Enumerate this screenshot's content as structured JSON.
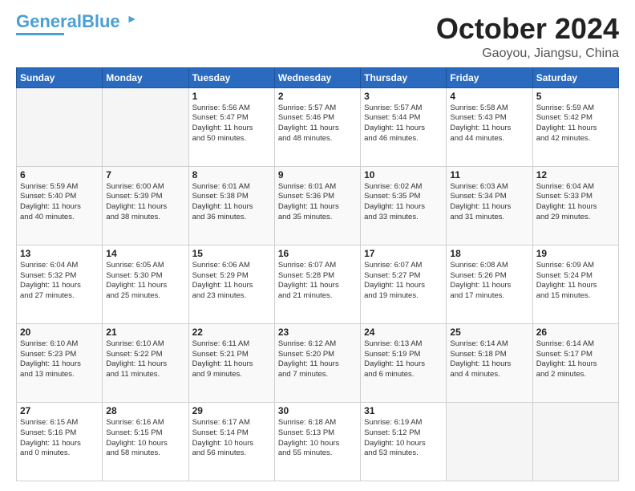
{
  "header": {
    "logo_general": "General",
    "logo_blue": "Blue",
    "month_year": "October 2024",
    "location": "Gaoyou, Jiangsu, China"
  },
  "days_of_week": [
    "Sunday",
    "Monday",
    "Tuesday",
    "Wednesday",
    "Thursday",
    "Friday",
    "Saturday"
  ],
  "weeks": [
    [
      {
        "day": "",
        "info": ""
      },
      {
        "day": "",
        "info": ""
      },
      {
        "day": "1",
        "info": "Sunrise: 5:56 AM\nSunset: 5:47 PM\nDaylight: 11 hours\nand 50 minutes."
      },
      {
        "day": "2",
        "info": "Sunrise: 5:57 AM\nSunset: 5:46 PM\nDaylight: 11 hours\nand 48 minutes."
      },
      {
        "day": "3",
        "info": "Sunrise: 5:57 AM\nSunset: 5:44 PM\nDaylight: 11 hours\nand 46 minutes."
      },
      {
        "day": "4",
        "info": "Sunrise: 5:58 AM\nSunset: 5:43 PM\nDaylight: 11 hours\nand 44 minutes."
      },
      {
        "day": "5",
        "info": "Sunrise: 5:59 AM\nSunset: 5:42 PM\nDaylight: 11 hours\nand 42 minutes."
      }
    ],
    [
      {
        "day": "6",
        "info": "Sunrise: 5:59 AM\nSunset: 5:40 PM\nDaylight: 11 hours\nand 40 minutes."
      },
      {
        "day": "7",
        "info": "Sunrise: 6:00 AM\nSunset: 5:39 PM\nDaylight: 11 hours\nand 38 minutes."
      },
      {
        "day": "8",
        "info": "Sunrise: 6:01 AM\nSunset: 5:38 PM\nDaylight: 11 hours\nand 36 minutes."
      },
      {
        "day": "9",
        "info": "Sunrise: 6:01 AM\nSunset: 5:36 PM\nDaylight: 11 hours\nand 35 minutes."
      },
      {
        "day": "10",
        "info": "Sunrise: 6:02 AM\nSunset: 5:35 PM\nDaylight: 11 hours\nand 33 minutes."
      },
      {
        "day": "11",
        "info": "Sunrise: 6:03 AM\nSunset: 5:34 PM\nDaylight: 11 hours\nand 31 minutes."
      },
      {
        "day": "12",
        "info": "Sunrise: 6:04 AM\nSunset: 5:33 PM\nDaylight: 11 hours\nand 29 minutes."
      }
    ],
    [
      {
        "day": "13",
        "info": "Sunrise: 6:04 AM\nSunset: 5:32 PM\nDaylight: 11 hours\nand 27 minutes."
      },
      {
        "day": "14",
        "info": "Sunrise: 6:05 AM\nSunset: 5:30 PM\nDaylight: 11 hours\nand 25 minutes."
      },
      {
        "day": "15",
        "info": "Sunrise: 6:06 AM\nSunset: 5:29 PM\nDaylight: 11 hours\nand 23 minutes."
      },
      {
        "day": "16",
        "info": "Sunrise: 6:07 AM\nSunset: 5:28 PM\nDaylight: 11 hours\nand 21 minutes."
      },
      {
        "day": "17",
        "info": "Sunrise: 6:07 AM\nSunset: 5:27 PM\nDaylight: 11 hours\nand 19 minutes."
      },
      {
        "day": "18",
        "info": "Sunrise: 6:08 AM\nSunset: 5:26 PM\nDaylight: 11 hours\nand 17 minutes."
      },
      {
        "day": "19",
        "info": "Sunrise: 6:09 AM\nSunset: 5:24 PM\nDaylight: 11 hours\nand 15 minutes."
      }
    ],
    [
      {
        "day": "20",
        "info": "Sunrise: 6:10 AM\nSunset: 5:23 PM\nDaylight: 11 hours\nand 13 minutes."
      },
      {
        "day": "21",
        "info": "Sunrise: 6:10 AM\nSunset: 5:22 PM\nDaylight: 11 hours\nand 11 minutes."
      },
      {
        "day": "22",
        "info": "Sunrise: 6:11 AM\nSunset: 5:21 PM\nDaylight: 11 hours\nand 9 minutes."
      },
      {
        "day": "23",
        "info": "Sunrise: 6:12 AM\nSunset: 5:20 PM\nDaylight: 11 hours\nand 7 minutes."
      },
      {
        "day": "24",
        "info": "Sunrise: 6:13 AM\nSunset: 5:19 PM\nDaylight: 11 hours\nand 6 minutes."
      },
      {
        "day": "25",
        "info": "Sunrise: 6:14 AM\nSunset: 5:18 PM\nDaylight: 11 hours\nand 4 minutes."
      },
      {
        "day": "26",
        "info": "Sunrise: 6:14 AM\nSunset: 5:17 PM\nDaylight: 11 hours\nand 2 minutes."
      }
    ],
    [
      {
        "day": "27",
        "info": "Sunrise: 6:15 AM\nSunset: 5:16 PM\nDaylight: 11 hours\nand 0 minutes."
      },
      {
        "day": "28",
        "info": "Sunrise: 6:16 AM\nSunset: 5:15 PM\nDaylight: 10 hours\nand 58 minutes."
      },
      {
        "day": "29",
        "info": "Sunrise: 6:17 AM\nSunset: 5:14 PM\nDaylight: 10 hours\nand 56 minutes."
      },
      {
        "day": "30",
        "info": "Sunrise: 6:18 AM\nSunset: 5:13 PM\nDaylight: 10 hours\nand 55 minutes."
      },
      {
        "day": "31",
        "info": "Sunrise: 6:19 AM\nSunset: 5:12 PM\nDaylight: 10 hours\nand 53 minutes."
      },
      {
        "day": "",
        "info": ""
      },
      {
        "day": "",
        "info": ""
      }
    ]
  ]
}
